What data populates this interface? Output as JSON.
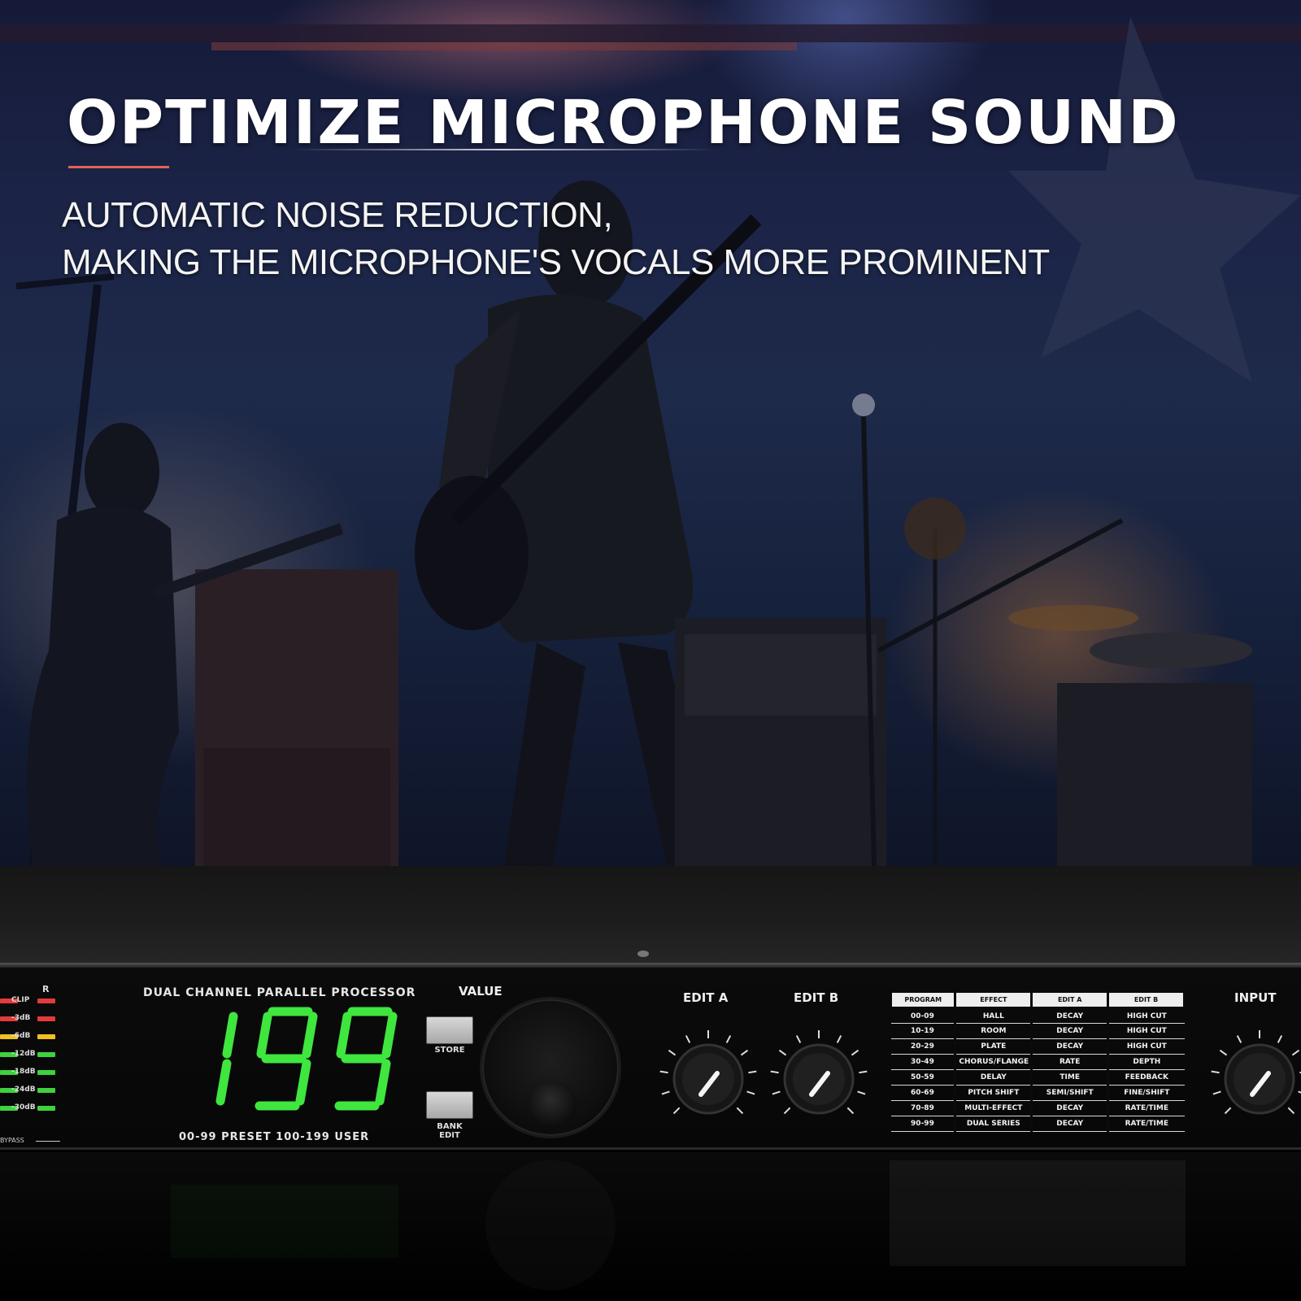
{
  "banner": {
    "headline": "OPTIMIZE MICROPHONE SOUND",
    "subline_1": "AUTOMATIC NOISE REDUCTION,",
    "subline_2": "MAKING THE MICROPHONE'S VOCALS MORE PROMINENT",
    "accent_color": "#e0645a"
  },
  "device": {
    "meter": {
      "right_channel_label": "R",
      "rows": [
        {
          "label": "CLIP",
          "color": "#e23b3b"
        },
        {
          "label": "-3dB",
          "color": "#e23b3b"
        },
        {
          "label": "-6dB",
          "color": "#f0c020"
        },
        {
          "label": "-12dB",
          "color": "#3fd13f"
        },
        {
          "label": "-18dB",
          "color": "#3fd13f"
        },
        {
          "label": "-24dB",
          "color": "#3fd13f"
        },
        {
          "label": "-30dB",
          "color": "#3fd13f"
        }
      ],
      "bypass_label": "BYPASS"
    },
    "processor_title": "DUAL CHANNEL PARALLEL PROCESSOR",
    "display_value": "199",
    "display_color": "#3ee63e",
    "preset_range_label": "00-99 PRESET 100-199 USER",
    "value_label": "VALUE",
    "store_label": "STORE",
    "bank_label_1": "BANK",
    "bank_label_2": "EDIT",
    "edit_a_label": "EDIT A",
    "edit_b_label": "EDIT B",
    "input_label": "INPUT",
    "fx_table": {
      "headers": [
        "PROGRAM",
        "EFFECT",
        "EDIT A",
        "EDIT B"
      ],
      "rows": [
        [
          "00-09",
          "HALL",
          "DECAY",
          "HIGH CUT"
        ],
        [
          "10-19",
          "ROOM",
          "DECAY",
          "HIGH CUT"
        ],
        [
          "20-29",
          "PLATE",
          "DECAY",
          "HIGH CUT"
        ],
        [
          "30-49",
          "CHORUS/FLANGE",
          "RATE",
          "DEPTH"
        ],
        [
          "50-59",
          "DELAY",
          "TIME",
          "FEEDBACK"
        ],
        [
          "60-69",
          "PITCH SHIFT",
          "SEMI/SHIFT",
          "FINE/SHIFT"
        ],
        [
          "70-89",
          "MULTI-EFFECT",
          "DECAY",
          "RATE/TIME"
        ],
        [
          "90-99",
          "DUAL SERIES",
          "DECAY",
          "RATE/TIME"
        ]
      ]
    }
  }
}
